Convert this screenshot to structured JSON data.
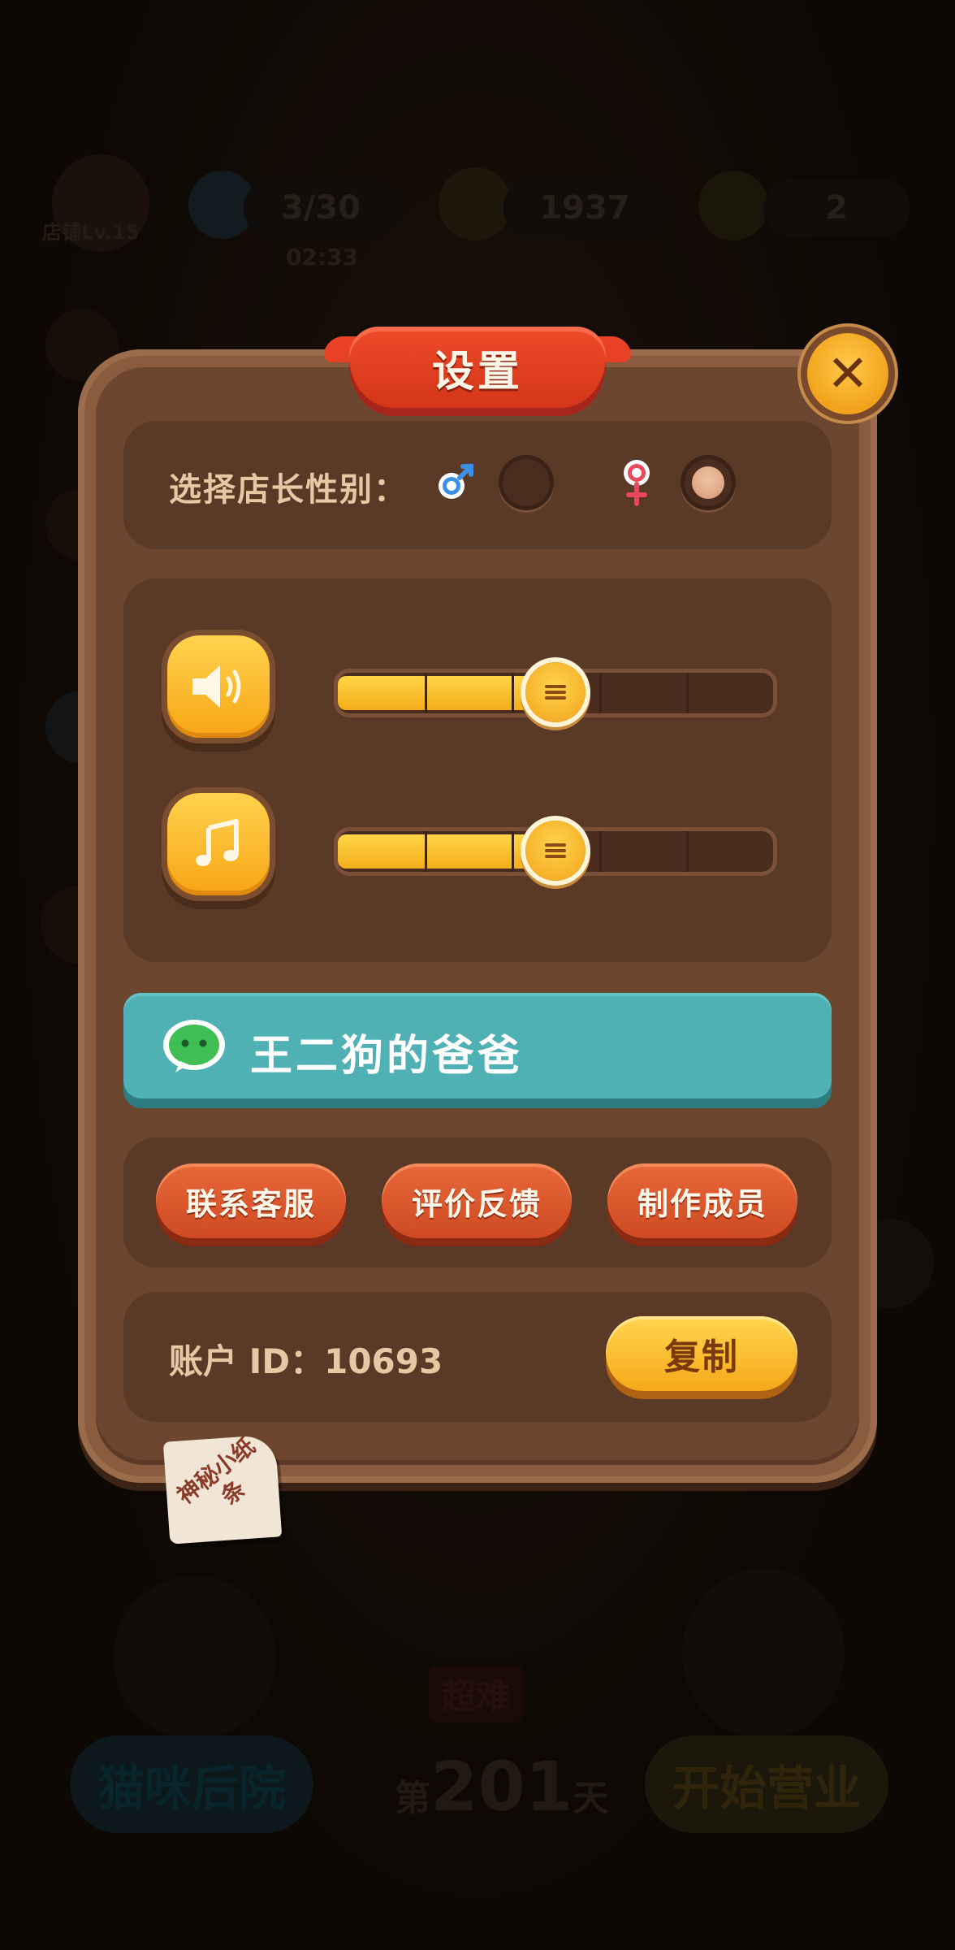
{
  "background": {
    "level_badge": "店铺Lv.15",
    "energy": "3/30",
    "energy_timer": "02:33",
    "coins": "1937",
    "stars": "2",
    "difficulty_badge": "超难",
    "day_prefix": "第",
    "day_number": "201",
    "day_suffix": "天",
    "left_button": "猫咪后院",
    "right_button": "开始营业"
  },
  "settings": {
    "title": "设置",
    "close_icon": "close-x",
    "gender": {
      "label": "选择店长性别：",
      "options": [
        {
          "icon": "male-symbol-icon",
          "selected": false
        },
        {
          "icon": "female-symbol-icon",
          "selected": true
        }
      ]
    },
    "sound": {
      "icon": "speaker-icon",
      "level": 0.5
    },
    "music": {
      "icon": "music-note-icon",
      "level": 0.5
    },
    "wechat": {
      "icon": "wechat-icon",
      "name": "王二狗的爸爸"
    },
    "buttons": {
      "contact": "联系客服",
      "feedback": "评价反馈",
      "credits": "制作成员"
    },
    "account": {
      "text": "账户 ID：10693",
      "copy_label": "复制"
    },
    "note": "神秘小纸条"
  },
  "colors": {
    "panel": "#8a5c3f",
    "ribbon": "#e84126",
    "accent_yellow": "#f7a515",
    "wechat_bar": "#4fb1b3",
    "red_button": "#d8552b"
  }
}
